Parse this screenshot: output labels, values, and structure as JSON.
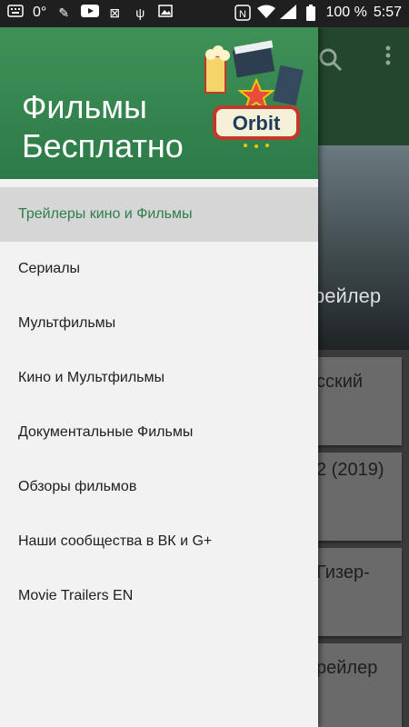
{
  "status_bar": {
    "left_text": "0°",
    "battery_text": "100 %",
    "time": "5:57",
    "icons": [
      "keyboard-icon",
      "brush-icon",
      "youtube-icon",
      "no-signal-icon",
      "usb-icon",
      "image-icon",
      "nfc-icon",
      "wifi-icon",
      "signal-icon",
      "battery-icon"
    ]
  },
  "drawer": {
    "title": "Фильмы Бесплатно",
    "logo_text": "Orbit",
    "items": [
      {
        "label": "Трейлеры кино и Фильмы",
        "active": true
      },
      {
        "label": "Сериалы"
      },
      {
        "label": "Мультфильмы"
      },
      {
        "label": "Кино и Мультфильмы"
      },
      {
        "label": "Документальные Фильмы"
      },
      {
        "label": "Обзоры фильмов"
      },
      {
        "label": "Наши сообщества в ВК и G+"
      },
      {
        "label": "Movie Trailers EN"
      }
    ]
  },
  "background": {
    "hero_fragment": "рейлер",
    "cards": [
      "сский",
      "2 (2019)",
      "Гизер-",
      "рейлер"
    ]
  },
  "colors": {
    "header_green": "#2d7a48",
    "active_text": "#2e7d4a",
    "active_bg": "#d6d6d6"
  }
}
